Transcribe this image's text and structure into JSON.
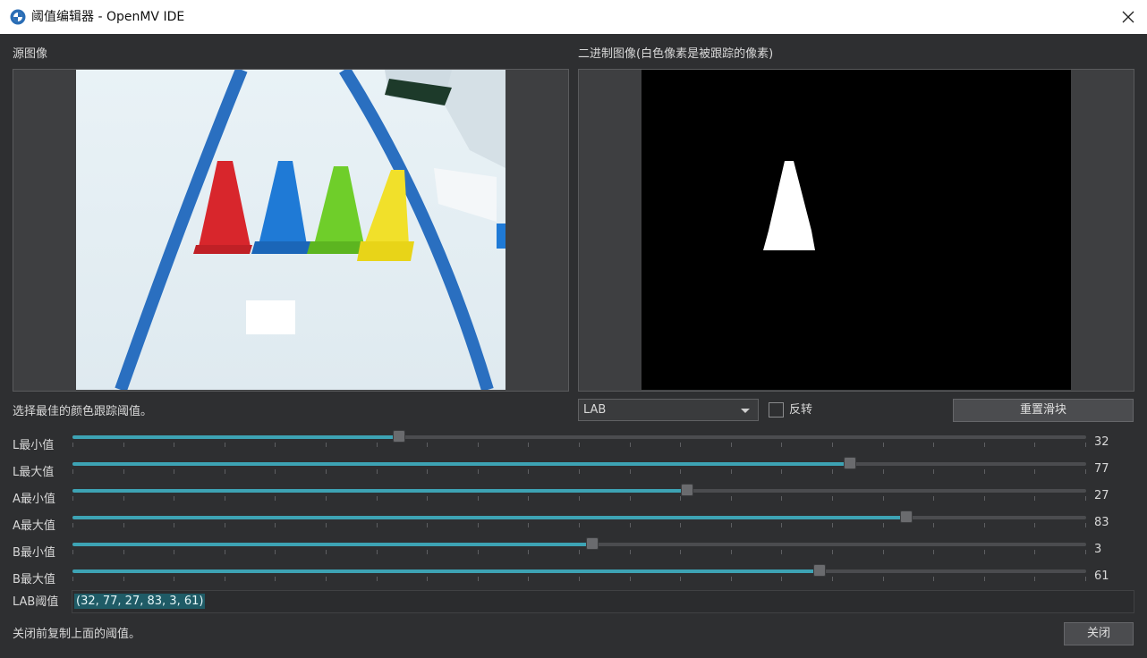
{
  "window": {
    "title": "阈值编辑器 - OpenMV IDE"
  },
  "source_panel": {
    "label": "源图像"
  },
  "binary_panel": {
    "label": "二进制图像(白色像素是被跟踪的像素)"
  },
  "instruction": "选择最佳的颜色跟踪阈值。",
  "color_space_select": {
    "selected": "LAB"
  },
  "invert_checkbox": {
    "label": "反转",
    "checked": false
  },
  "reset_button": {
    "label": "重置滑块"
  },
  "sliders": [
    {
      "label": "L最小值",
      "value": "32",
      "fraction": 0.322
    },
    {
      "label": "L最大值",
      "value": "77",
      "fraction": 0.767
    },
    {
      "label": "A最小值",
      "value": "27",
      "fraction": 0.606
    },
    {
      "label": "A最大值",
      "value": "83",
      "fraction": 0.823
    },
    {
      "label": "B最小值",
      "value": "3",
      "fraction": 0.513
    },
    {
      "label": "B最大值",
      "value": "61",
      "fraction": 0.737
    }
  ],
  "lab_threshold": {
    "label": "LAB阈值",
    "value": "(32, 77, 27, 83, 3, 61)"
  },
  "footer": {
    "note": "关闭前复制上面的阈值。",
    "close_label": "关闭"
  },
  "colors": {
    "accent": "#3da3b4",
    "background": "#2e2f31",
    "cone_red": "#d8262c",
    "cone_blue": "#1f7ad6",
    "cone_green": "#6fce2a",
    "cone_yellow": "#f1e02a",
    "lane_blue": "#2a6fc0"
  }
}
